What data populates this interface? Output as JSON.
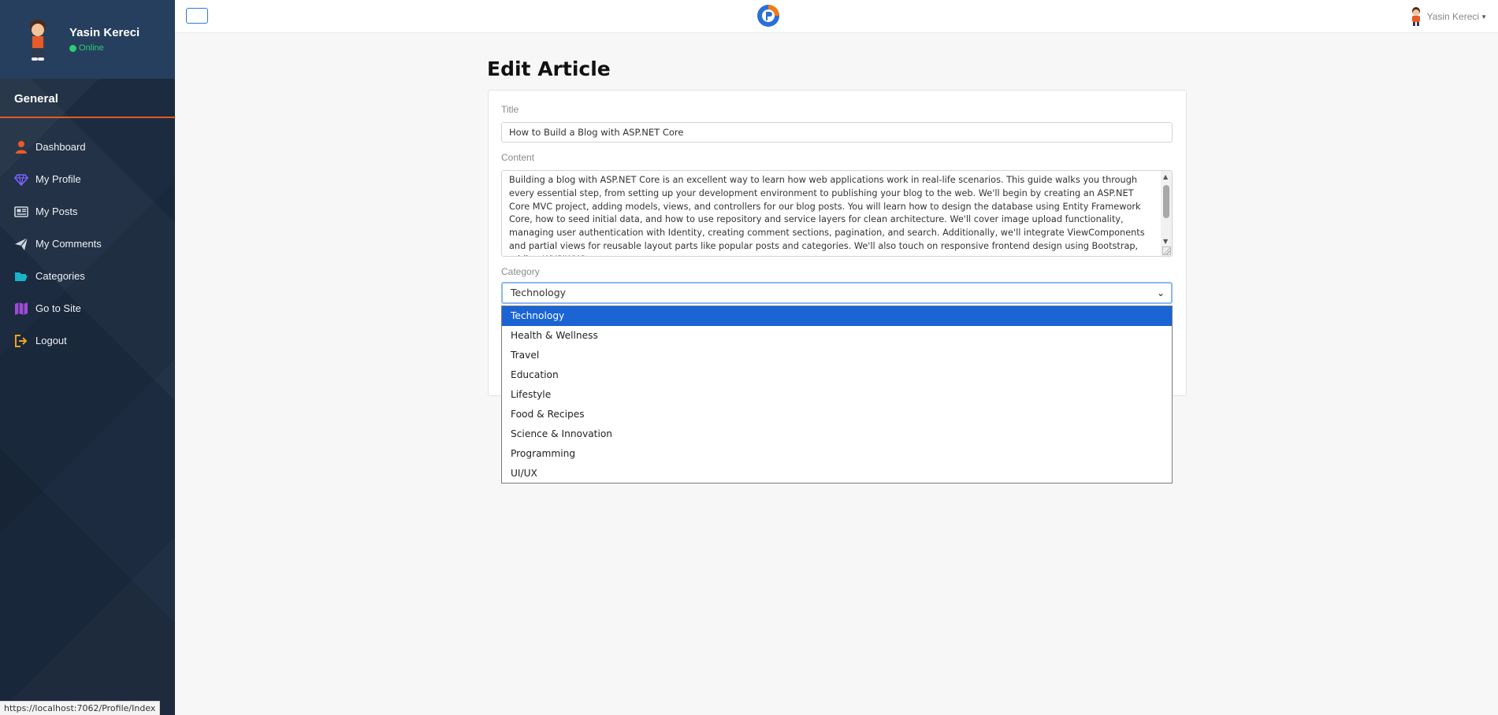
{
  "sidebar": {
    "user_name": "Yasin Kereci",
    "user_status": "Online",
    "section_title": "General",
    "items": [
      {
        "label": "Dashboard",
        "icon": "user-icon",
        "color": "#ec5b24"
      },
      {
        "label": "My Profile",
        "icon": "diamond-icon",
        "color": "#7b61ff"
      },
      {
        "label": "My Posts",
        "icon": "newspaper-icon",
        "color": "#cfd6df"
      },
      {
        "label": "My Comments",
        "icon": "paper-plane-icon",
        "color": "#cfd6df"
      },
      {
        "label": "Categories",
        "icon": "folder-open-icon",
        "color": "#16b5c9"
      },
      {
        "label": "Go to Site",
        "icon": "map-icon",
        "color": "#a04bd8"
      },
      {
        "label": "Logout",
        "icon": "sign-out-icon",
        "color": "#f0a11c"
      }
    ]
  },
  "topbar": {
    "user_name": "Yasin Kereci"
  },
  "page": {
    "title": "Edit Article",
    "form": {
      "title_label": "Title",
      "title_value": "How to Build a Blog with ASP.NET Core",
      "content_label": "Content",
      "content_value": "Building a blog with ASP.NET Core is an excellent way to learn how web applications work in real-life scenarios. This guide walks you through every essential step, from setting up your development environment to publishing your blog to the web. We'll begin by creating an ASP.NET Core MVC project, adding models, views, and controllers for our blog posts. You will learn how to design the database using Entity Framework Core, how to seed initial data, and how to use repository and service layers for clean architecture. We'll cover image upload functionality, managing user authentication with Identity, creating comment sections, pagination, and search. Additionally, we'll integrate ViewComponents and partial views for reusable layout parts like popular posts and categories. We'll also touch on responsive frontend design using Bootstrap, adding WYSIWYG",
      "category_label": "Category",
      "category_selected": "Technology",
      "category_options": [
        "Technology",
        "Health & Wellness",
        "Travel",
        "Education",
        "Lifestyle",
        "Food & Recipes",
        "Science & Innovation",
        "Programming",
        "UI/UX"
      ]
    }
  },
  "statusbar": {
    "url": "https://localhost:7062/Profile/Index"
  },
  "colors": {
    "accent": "#e8571f",
    "selected_option": "#1a64d3",
    "sidebar_bg": "#1c2b40",
    "online": "#2ecc71"
  }
}
